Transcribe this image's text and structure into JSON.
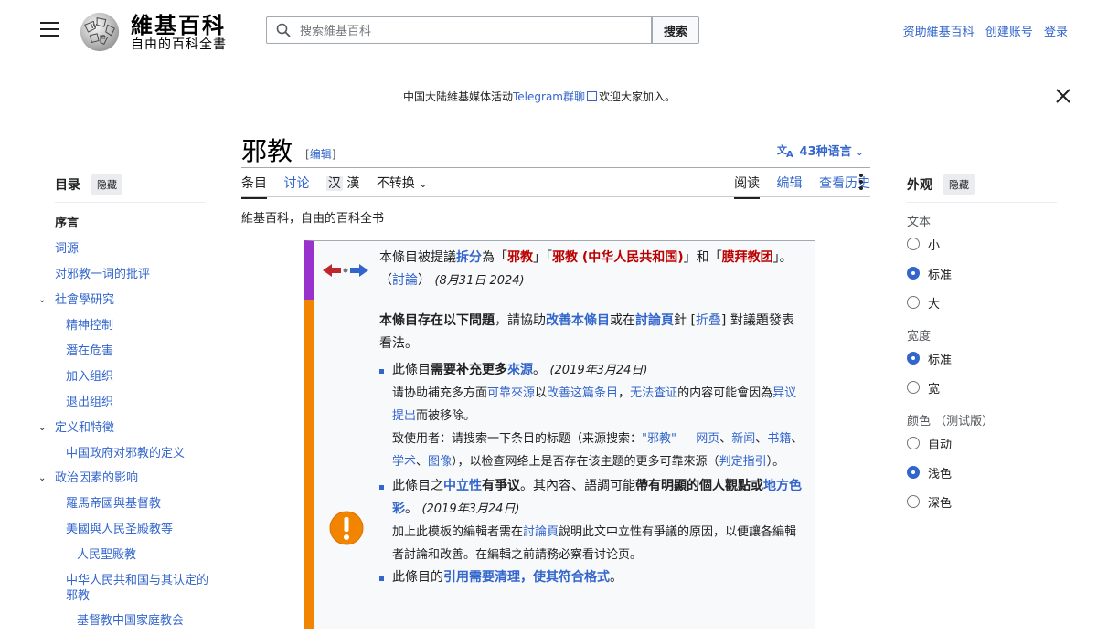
{
  "header": {
    "wordmark": "維基百科",
    "tagline": "自由的百科全書",
    "search_placeholder": "搜索維基百科",
    "search_button": "搜索",
    "links": [
      "资助維基百科",
      "创建账号",
      "登录"
    ]
  },
  "banner": {
    "text_before": "中国大陆維基媒体活动",
    "link": "Telegram群聊",
    "text_after": "欢迎大家加入。"
  },
  "toc": {
    "title": "目录",
    "hide": "隐藏",
    "items": [
      {
        "label": "序言",
        "level": 1,
        "current": true
      },
      {
        "label": "词源",
        "level": 1
      },
      {
        "label": "对邪教一词的批评",
        "level": 1
      },
      {
        "label": "社會學研究",
        "level": 1,
        "expandable": true
      },
      {
        "label": "精神控制",
        "level": 2
      },
      {
        "label": "潛在危害",
        "level": 2
      },
      {
        "label": "加入组织",
        "level": 2
      },
      {
        "label": "退出组织",
        "level": 2
      },
      {
        "label": "定义和特徵",
        "level": 1,
        "expandable": true
      },
      {
        "label": "中国政府对邪教的定义",
        "level": 2
      },
      {
        "label": "政治因素的影响",
        "level": 1,
        "expandable": true
      },
      {
        "label": "羅馬帝國與基督教",
        "level": 2
      },
      {
        "label": "美國與人民圣殿教等",
        "level": 2
      },
      {
        "label": "人民聖殿教",
        "level": 3
      },
      {
        "label": "中华人民共和国与其认定的邪教",
        "level": 2
      },
      {
        "label": "基督教中国家庭教会",
        "level": 3
      }
    ]
  },
  "article": {
    "title": "邪教",
    "edit_label": "[编辑]",
    "languages": "43种语言",
    "tabs_left": [
      "条目",
      "讨论"
    ],
    "variant_a": "汉",
    "variant_b": "漢",
    "variant_dropdown": "不转换",
    "tabs_right": [
      "阅读",
      "编辑",
      "查看历史"
    ],
    "subtitle": "維基百科，自由的百科全书"
  },
  "merge_box": {
    "t1": "本條目被提議",
    "t2": "拆分",
    "t3": "為「",
    "t4": "邪教",
    "t5": "」「",
    "t6": "邪教 (中华人民共和国)",
    "t7": "」和「",
    "t8": "膜拜教团",
    "t9": "」。（",
    "t10": "討論",
    "t11": "）",
    "date": "(8月31日 2024)"
  },
  "issues_box": {
    "intro_a": "本條目存在以下問題",
    "intro_b": "，請協助",
    "intro_c": "改善本條目",
    "intro_d": "或在",
    "intro_e": "討論頁",
    "intro_f": "針 [",
    "intro_g": "折叠",
    "intro_h": "] 對議題發表看法。",
    "i1_a": "此條目",
    "i1_b": "需要补充更多",
    "i1_c": "來源",
    "i1_d": "。",
    "i1_date": "(2019年3月24日)",
    "i1_s1": "请协助補充多方面",
    "i1_s2": "可靠來源",
    "i1_s3": "以",
    "i1_s4": "改善这篇条目",
    "i1_s5": "，",
    "i1_s6": "无法查证",
    "i1_s7": "的内容可能會因為",
    "i1_s8": "异议提出",
    "i1_s9": "而被移除。",
    "i1_n1": "致使用者：请搜索一下条目的标题（来源搜索：",
    "i1_n2": "\"邪教\"",
    "i1_n3": " — ",
    "i1_n4": "网页",
    "i1_n5": "、",
    "i1_n6": "新闻",
    "i1_n7": "、",
    "i1_n8": "书籍",
    "i1_n9": "、",
    "i1_n10": "学术",
    "i1_n11": "、",
    "i1_n12": "图像",
    "i1_n13": "），以检查网络上是否存在该主题的更多可靠來源（",
    "i1_n14": "判定指引",
    "i1_n15": "）。",
    "i2_a": "此條目之",
    "i2_b": "中立性",
    "i2_c": "有爭议",
    "i2_d": "。其內容、語調可能",
    "i2_e": "帶有明顯的個人觀點",
    "i2_f": "或",
    "i2_g": "地方色彩",
    "i2_h": "。",
    "i2_date": "(2019年3月24日)",
    "i2_s1": "加上此模板的編輯者需在",
    "i2_s2": "討論頁",
    "i2_s3": "說明此文中立性有爭議的原因，以便讓各編輯者討論和改善。在編輯之前請務必察看讨论页。",
    "i3_a": "此條目的",
    "i3_b": "引用需要清理，使其符合格式",
    "i3_c": "。"
  },
  "appearance": {
    "title": "外观",
    "hide": "隐藏",
    "text_label": "文本",
    "text_options": [
      "小",
      "标准",
      "大"
    ],
    "text_selected": "标准",
    "width_label": "宽度",
    "width_options": [
      "标准",
      "宽"
    ],
    "width_selected": "标准",
    "color_label": "颜色 （测试版）",
    "color_options": [
      "自动",
      "浅色",
      "深色"
    ],
    "color_selected": "浅色"
  },
  "colors": {
    "link": "#3366cc",
    "red_link": "#ba0000",
    "merge_bar": "#9932cc",
    "issue_bar": "#f28500"
  }
}
